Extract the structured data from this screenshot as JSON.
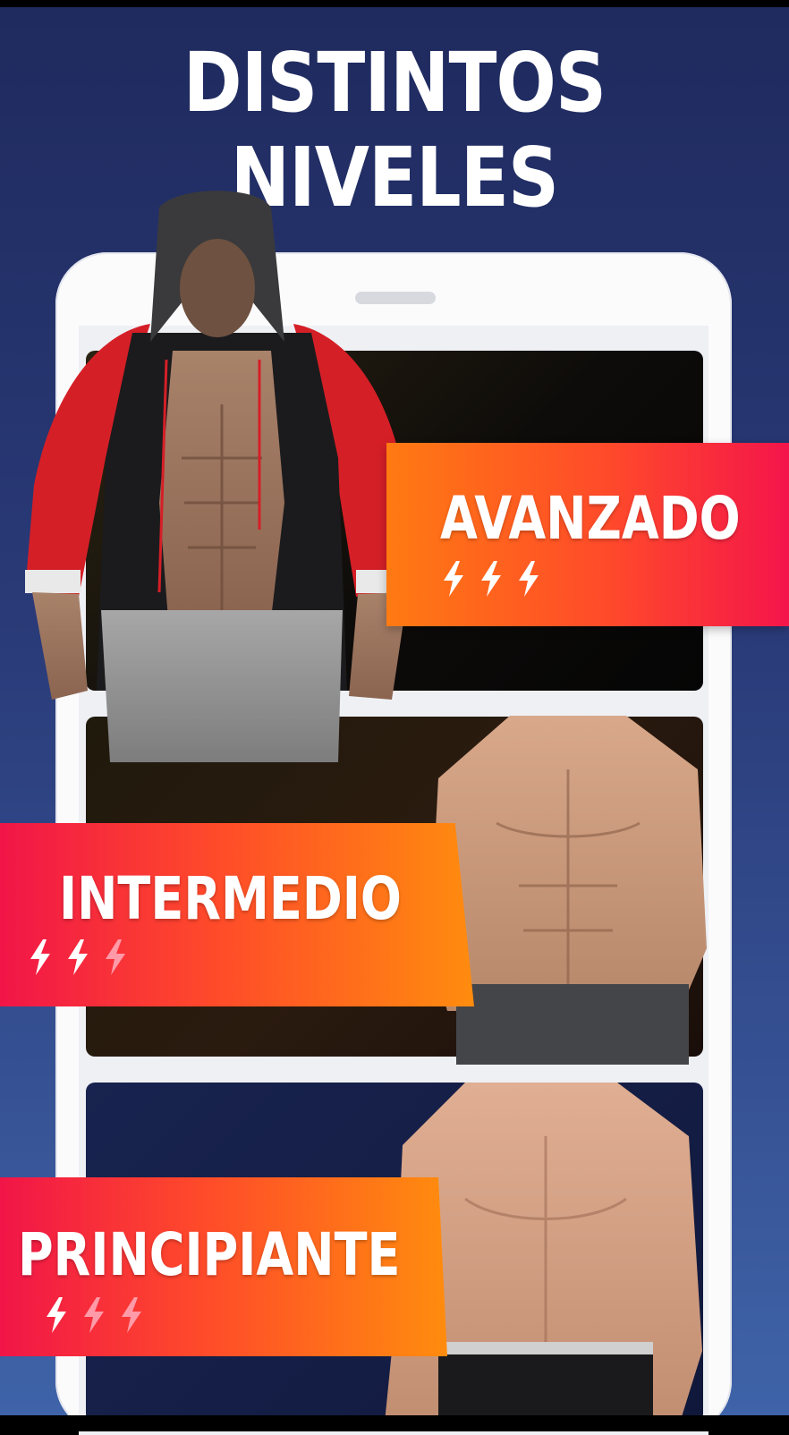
{
  "headline": {
    "line1": "DISTINTOS",
    "line2": "NIVELES"
  },
  "levels": [
    {
      "label": "AVANZADO",
      "intensity": 3,
      "max_intensity": 3,
      "icon": "lightning-icon"
    },
    {
      "label": "INTERMEDIO",
      "intensity": 2,
      "max_intensity": 3,
      "icon": "lightning-icon"
    },
    {
      "label": "PRINCIPIANTE",
      "intensity": 1,
      "max_intensity": 3,
      "icon": "lightning-icon"
    }
  ],
  "colors": {
    "background_top": "#1f2a5e",
    "background_bottom": "#3f63a8",
    "banner_orange": "#ff7a12",
    "banner_red": "#f4154a",
    "phone_frame": "#fbfbfc",
    "bolt_active": "#ffffff",
    "bolt_inactive": "#ff9aa8"
  }
}
